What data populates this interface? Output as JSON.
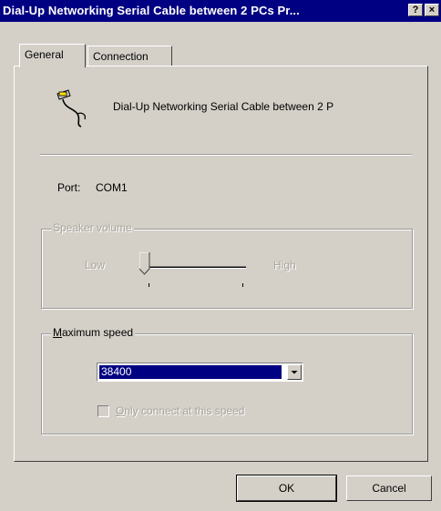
{
  "window": {
    "title": "Dial-Up Networking Serial Cable between 2 PCs Pr...",
    "help_button": "?",
    "close_button": "×"
  },
  "tabs": [
    {
      "label": "General",
      "active": true
    },
    {
      "label": "Connection",
      "active": false
    }
  ],
  "device": {
    "icon": "serial-cable-icon",
    "name": "Dial-Up Networking Serial Cable between 2 P"
  },
  "port": {
    "label": "Port:",
    "value": "COM1"
  },
  "speaker_volume": {
    "title": "Speaker volume",
    "low_label": "Low",
    "high_label": "High",
    "level": 0,
    "enabled": false
  },
  "maximum_speed": {
    "title_accel": "M",
    "title_rest": "aximum speed",
    "selected": "38400",
    "only_connect": {
      "label_accel": "O",
      "label_rest": "nly connect at this speed",
      "checked": false,
      "enabled": false
    }
  },
  "buttons": {
    "ok": "OK",
    "cancel": "Cancel"
  },
  "colors": {
    "titlebar": "#000082",
    "face": "#d4d0c8",
    "selection": "#000082"
  }
}
